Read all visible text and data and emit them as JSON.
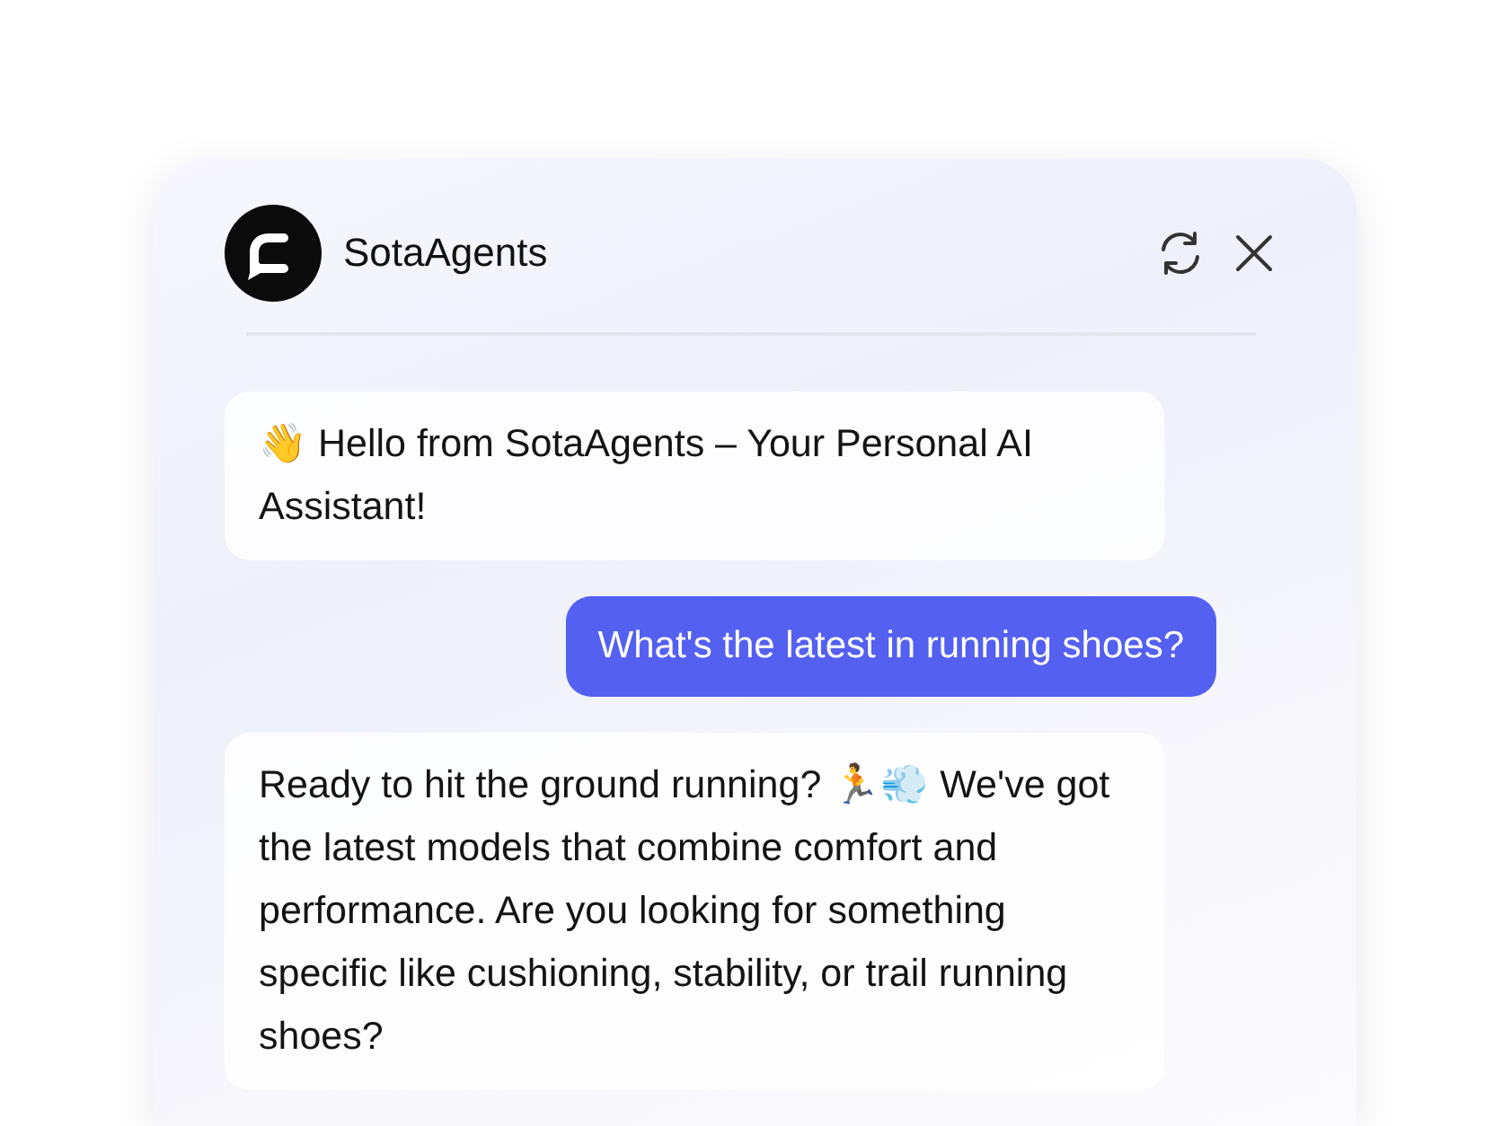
{
  "header": {
    "title": "SotaAgents"
  },
  "messages": [
    {
      "kind": "bot",
      "text": "👋 Hello from SotaAgents – Your Personal AI Assistant!"
    },
    {
      "kind": "user",
      "text": "What's the latest in running shoes?"
    },
    {
      "kind": "bot",
      "text": "Ready to hit the ground running? 🏃💨 We've got the latest models that combine comfort and performance. Are you looking for something specific like cushioning, stability, or trail running shoes?"
    }
  ]
}
